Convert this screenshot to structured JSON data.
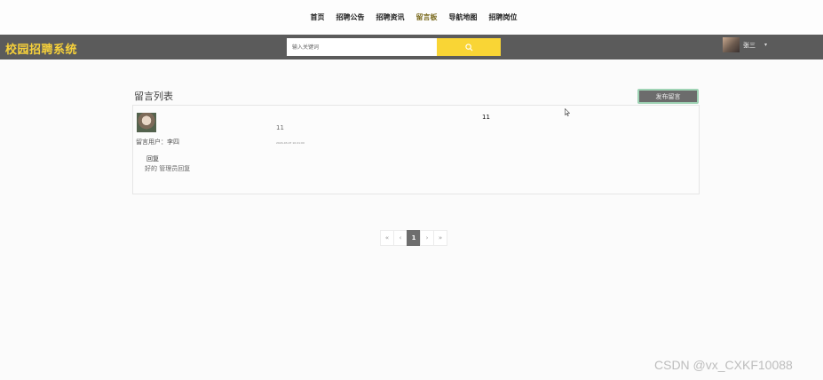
{
  "nav": {
    "items": [
      {
        "label": "首页"
      },
      {
        "label": "招聘公告"
      },
      {
        "label": "招聘资讯"
      },
      {
        "label": "留言板",
        "active": true
      },
      {
        "label": "导航地图"
      },
      {
        "label": "招聘岗位"
      }
    ]
  },
  "header": {
    "brand": "校园招聘系统",
    "search_placeholder": "输入关键词",
    "search_icon": "search-icon",
    "user_name": "张三",
    "caret": "▾"
  },
  "list": {
    "title": "留言列表",
    "publish_label": "发布留言"
  },
  "messages": [
    {
      "poster": "留言用户：李四",
      "content": "11",
      "time": "2024-03-07 10:21:00",
      "right_text": "11",
      "reply_label": "回复",
      "reply_text": "好的 管理员回复"
    }
  ],
  "pagination": {
    "first": "«",
    "prev": "‹",
    "current": "1",
    "next": "›",
    "last": "»"
  },
  "watermark": "CSDN @vx_CXKF10088",
  "colors": {
    "accent": "#f9d535",
    "header_bg": "#5b5b5b",
    "brand": "#f7d13a"
  }
}
